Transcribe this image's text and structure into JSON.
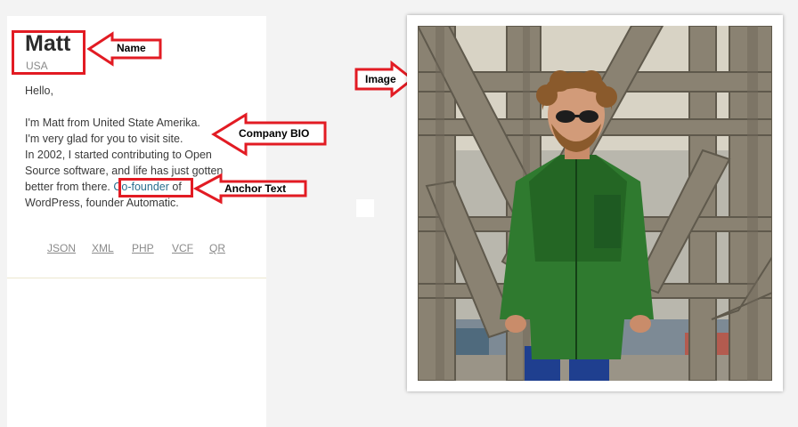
{
  "profile": {
    "name": "Matt",
    "country": "USA",
    "bio": {
      "greeting": "Hello,",
      "lines": [
        "I'm Matt from United State Amerika.",
        "I'm very glad for you to visit site.",
        "In 2002, I started contributing to Open",
        "Source software, and life has just gotten"
      ],
      "line_before_link": "better from there.",
      "link_text": "Co-founder",
      "line_after_link": "of",
      "last_line": "WordPress, founder Automatic."
    },
    "links": [
      "JSON",
      "XML",
      "PHP",
      "VCF",
      "QR"
    ]
  },
  "annotations": {
    "name_label": "Name",
    "bio_label": "Company BIO",
    "anchor_label": "Anchor Text",
    "image_label": "Image",
    "color": "#e21b23"
  },
  "photo": {
    "icon": "person-photo"
  }
}
